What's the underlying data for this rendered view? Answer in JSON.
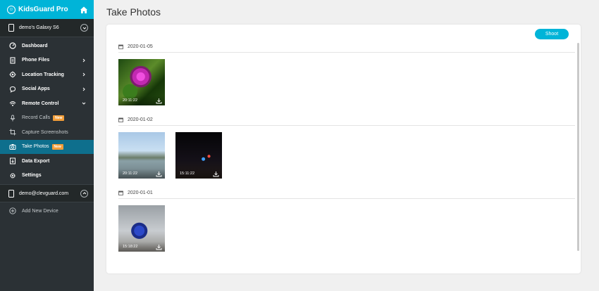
{
  "brand": {
    "name": "KidsGuard Pro"
  },
  "device": {
    "name": "demo's Galaxy S6"
  },
  "nav": [
    {
      "label": "Dashboard"
    },
    {
      "label": "Phone Files"
    },
    {
      "label": "Location Tracking"
    },
    {
      "label": "Social Apps"
    },
    {
      "label": "Remote Control"
    }
  ],
  "remote_sub": [
    {
      "label": "Record Calls",
      "badge": "New"
    },
    {
      "label": "Capture Screenshots"
    },
    {
      "label": "Take Photos",
      "badge": "New"
    }
  ],
  "nav_after": [
    {
      "label": "Data Export"
    },
    {
      "label": "Settings"
    }
  ],
  "account": {
    "email": "demo@clevguard.com"
  },
  "add_device": "Add New Device",
  "page": {
    "title": "Take Photos",
    "shoot_label": "Shoot"
  },
  "groups": [
    {
      "date": "2020-01-05",
      "photos": [
        {
          "time": "20:11:22"
        }
      ]
    },
    {
      "date": "2020-01-02",
      "photos": [
        {
          "time": "20:11:22"
        },
        {
          "time": "15:11:22"
        }
      ]
    },
    {
      "date": "2020-01-01",
      "photos": [
        {
          "time": "15:18:22"
        }
      ]
    }
  ],
  "colors": {
    "accent": "#00b4d8",
    "sidebar": "#2b3135",
    "active": "#0e6f8d",
    "badge": "#f29d38"
  }
}
